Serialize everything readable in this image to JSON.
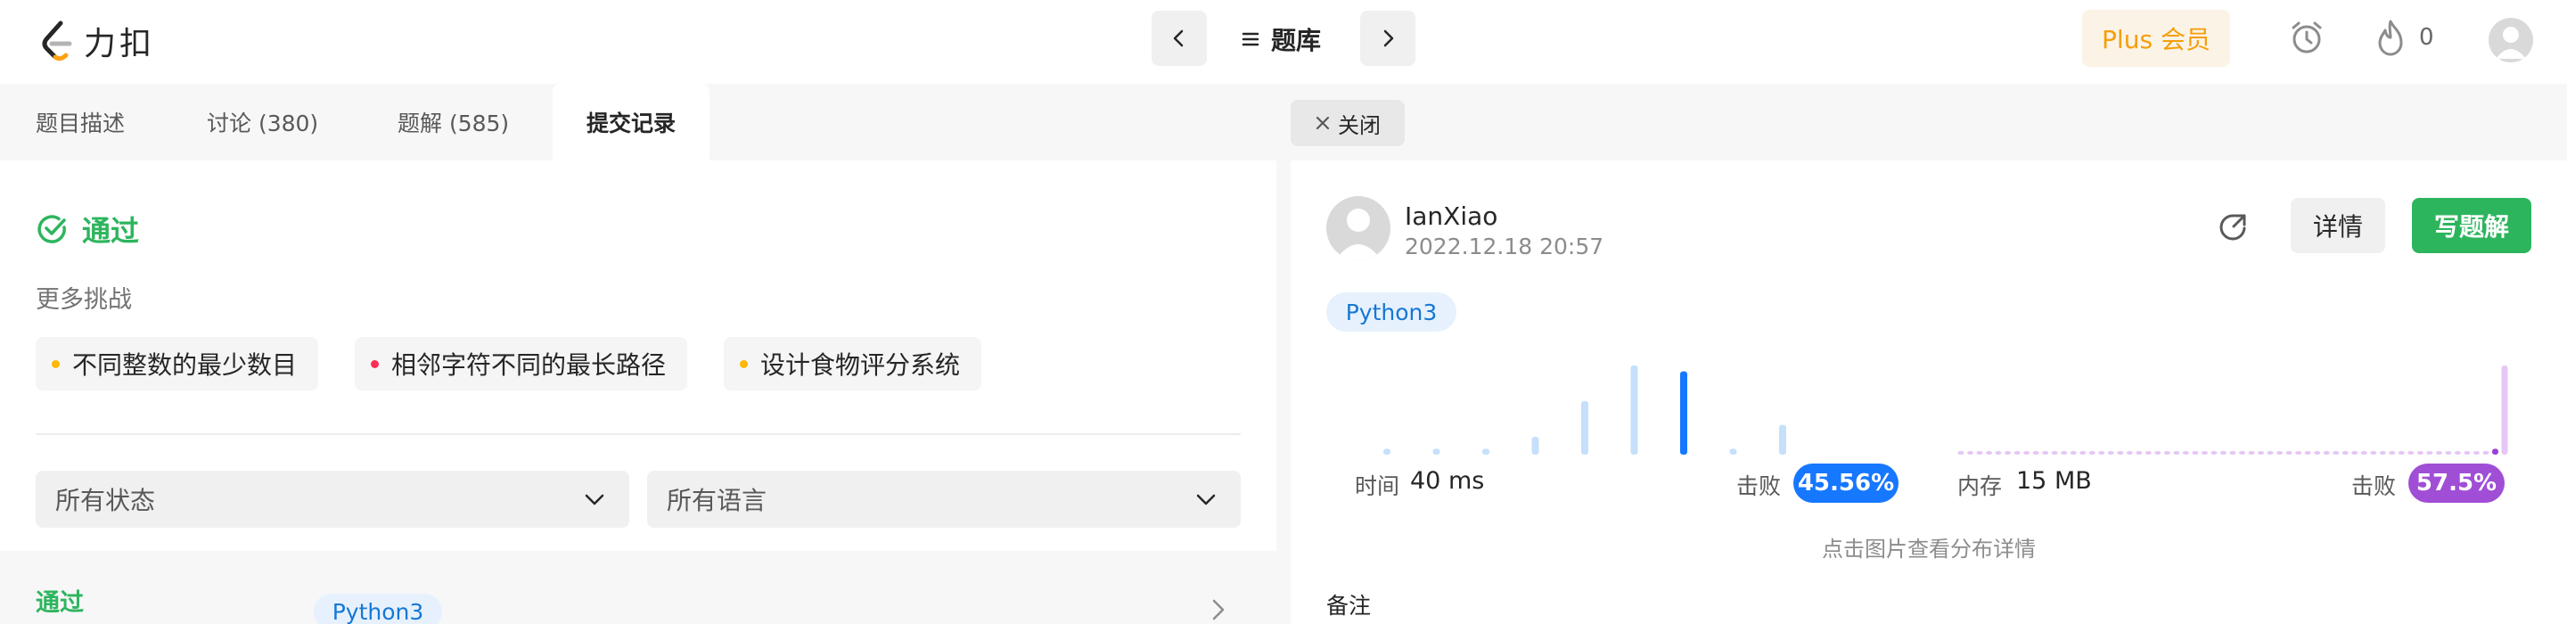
{
  "header": {
    "logo_text": "力扣",
    "center_title": "题库",
    "plus_label": "Plus 会员",
    "fire_count": "0"
  },
  "tabs": [
    {
      "label": "题目描述",
      "active": false
    },
    {
      "label": "讨论 (380)",
      "active": false
    },
    {
      "label": "题解 (585)",
      "active": false
    },
    {
      "label": "提交记录",
      "active": true
    }
  ],
  "result": {
    "status": "通过",
    "more_challenges_label": "更多挑战",
    "challenges": [
      {
        "title": "不同整数的最少数目",
        "color": "#ffb800"
      },
      {
        "title": "相邻字符不同的最长路径",
        "color": "#ff2d55"
      },
      {
        "title": "设计食物评分系统",
        "color": "#ffb800"
      }
    ]
  },
  "filters": {
    "status_select": "所有状态",
    "language_select": "所有语言"
  },
  "submission_row": {
    "status": "通过",
    "language": "Python3"
  },
  "detail": {
    "close_label": "关闭",
    "username": "IanXiao",
    "timestamp": "2022.12.18 20:57",
    "details_button": "详情",
    "write_solution_button": "写题解",
    "language_tag": "Python3",
    "time_label": "时间",
    "time_value": "40 ms",
    "time_beat_label": "击败",
    "time_beat_value": "45.56%",
    "memory_label": "内存",
    "memory_value": "15 MB",
    "memory_beat_label": "击败",
    "memory_beat_value": "57.5%",
    "hint": "点击图片查看分布详情",
    "notes_label": "备注"
  },
  "chart_data": [
    {
      "type": "bar",
      "title": "",
      "series": [
        {
          "values": [
            2,
            2,
            2,
            6,
            18,
            30,
            28,
            2,
            10
          ]
        }
      ],
      "highlight_index": 6,
      "colors": {
        "normal": "#c6e0fb",
        "highlight": "#1677ff"
      }
    },
    {
      "type": "bar",
      "title": "",
      "series": [
        {
          "values": [
            1,
            1,
            1,
            1,
            1,
            1,
            1,
            1,
            1,
            1,
            1,
            1,
            1,
            1,
            1,
            1,
            1,
            1,
            1,
            1,
            1,
            1,
            1,
            1,
            1,
            1,
            1,
            1,
            1,
            1,
            1,
            1,
            1,
            1,
            1,
            1,
            1,
            1,
            1,
            1,
            1,
            1,
            1,
            1,
            1,
            1,
            1,
            1,
            1,
            1,
            1,
            1,
            1,
            1,
            1,
            1,
            1,
            2,
            30
          ]
        }
      ],
      "highlight_index": 57,
      "colors": {
        "normal": "#e5c7f5",
        "highlight": "#9b3fd8"
      }
    }
  ],
  "colors": {
    "accent_green": "#2db55d",
    "accent_blue": "#1677ff",
    "accent_purple": "#a04ed6",
    "plus_orange": "#f59e0b"
  }
}
